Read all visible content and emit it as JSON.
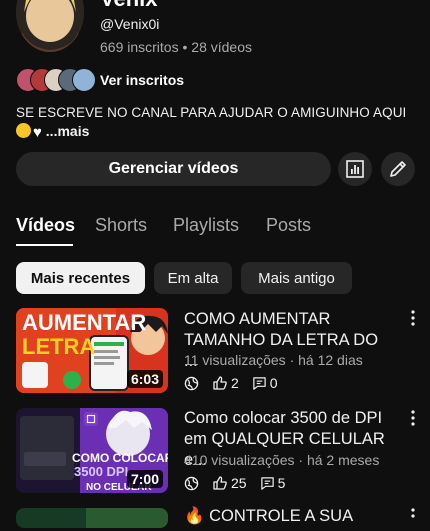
{
  "channel": {
    "name": "Venix",
    "handle": "@Venix0i",
    "subscribers": "669 inscritos",
    "videos_count": "28 vídeos",
    "see_subscribers_label": "Ver inscritos",
    "description": "SE ESCREVE NO CANAL PARA AJUDAR O AMIGUINHO AQUI",
    "more_label": "...mais"
  },
  "actions": {
    "manage_videos_label": "Gerenciar vídeos",
    "analytics_icon": "bar-chart-icon",
    "edit_icon": "pencil-icon"
  },
  "tabs": [
    {
      "label": "Vídeos",
      "active": true
    },
    {
      "label": "Shorts",
      "active": false
    },
    {
      "label": "Playlists",
      "active": false
    },
    {
      "label": "Posts",
      "active": false
    }
  ],
  "chips": [
    {
      "label": "Mais recentes",
      "active": true
    },
    {
      "label": "Em alta",
      "active": false
    },
    {
      "label": "Mais antigo",
      "active": false
    }
  ],
  "videos": [
    {
      "title_line1": "COMO AUMENTAR",
      "title_line2": "TAMANHO DA LETRA DO ...",
      "meta": "11 visualizações · há 12 dias",
      "likes": "2",
      "comments": "0",
      "duration": "6:03",
      "thumb_text_1": "AUMENTAR",
      "thumb_text_2": "LETRA"
    },
    {
      "title_line1": "Como colocar 3500 de DPI",
      "title_line2": "em QUALQUER CELULAR e...",
      "meta": "410 visualizações · há 2 meses",
      "likes": "25",
      "comments": "5",
      "duration": "7:00",
      "thumb_text_1": "COMO COLOCAR",
      "thumb_text_2": "3500 DPI",
      "thumb_text_3": "NO CELULAR"
    },
    {
      "title_line1": "CONTROLE A SUA"
    }
  ],
  "colors": {
    "background": "#0f0f0f",
    "chip": "#272727",
    "secondary_text": "#aaaaaa",
    "thumb1_red": "#d8331f",
    "thumb2_purple": "#6b2fb3"
  }
}
